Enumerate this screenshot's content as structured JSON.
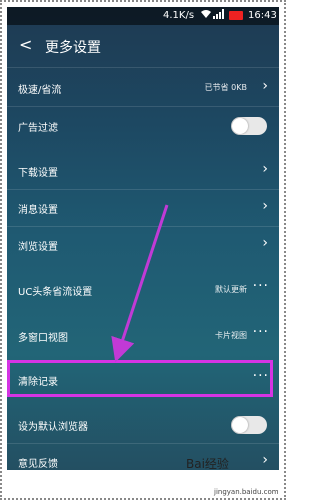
{
  "status_bar": {
    "speed": "4.1K/s",
    "time": "16:43"
  },
  "header": {
    "back": "<",
    "title": "更多设置"
  },
  "settings": [
    {
      "label": "极速/省流",
      "value": "已节省 0KB",
      "control": "chevron"
    },
    {
      "label": "广告过滤",
      "control": "toggle",
      "state": "off"
    },
    {
      "label": "下载设置",
      "control": "chevron"
    },
    {
      "label": "消息设置",
      "control": "chevron"
    },
    {
      "label": "浏览设置",
      "control": "chevron"
    },
    {
      "label": "UC头条省流设置",
      "value": "默认更新",
      "control": "dots"
    },
    {
      "label": "多窗口视图",
      "value": "卡片视图",
      "control": "dots"
    },
    {
      "label": "清除记录",
      "control": "dots"
    },
    {
      "label": "设为默认浏览器",
      "control": "toggle",
      "state": "off"
    },
    {
      "label": "意见反馈",
      "control": "chevron"
    }
  ],
  "glyphs": {
    "chevron": "›",
    "dots": "···"
  },
  "annotation": {
    "highlight_color": "#d534e4",
    "arrow_color": "#c13ad6"
  },
  "watermark": {
    "brand": "Bai经验",
    "url": "jingyan.baidu.com"
  }
}
